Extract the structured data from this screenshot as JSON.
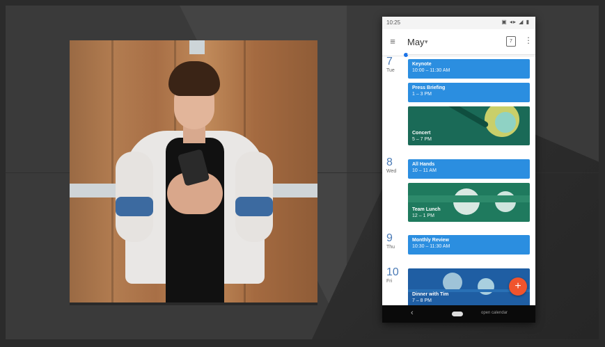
{
  "phone": {
    "status": {
      "time": "10:25",
      "icons": "▣ ◂▸ ◢ ▮"
    },
    "appbar": {
      "menu_icon": "≡",
      "month": "May",
      "caret": "▾",
      "calendar_day": "7",
      "more_icon": "⋮"
    },
    "days": [
      {
        "num": "7",
        "dow": "Tue"
      },
      {
        "num": "8",
        "dow": "Wed"
      },
      {
        "num": "9",
        "dow": "Thu"
      },
      {
        "num": "10",
        "dow": "Fri"
      }
    ],
    "events": [
      {
        "title": "Keynote",
        "time": "10:00 – 11:30 AM"
      },
      {
        "title": "Press Briefing",
        "time": "1 – 3 PM"
      },
      {
        "title": "Concert",
        "time": "5 – 7 PM"
      },
      {
        "title": "All Hands",
        "time": "10 – 11 AM"
      },
      {
        "title": "Team Lunch",
        "time": "12 – 1 PM"
      },
      {
        "title": "Monthly Review",
        "time": "10:30 – 11:30 AM"
      },
      {
        "title": "Dinner with Tim",
        "time": "7 – 8 PM"
      }
    ],
    "fab": "+",
    "nav": {
      "back": "‹",
      "label": "open calendar"
    }
  },
  "colors": {
    "accent": "#2b8ee0",
    "fab": "#f0542d",
    "image_event": "#1e6b55"
  }
}
